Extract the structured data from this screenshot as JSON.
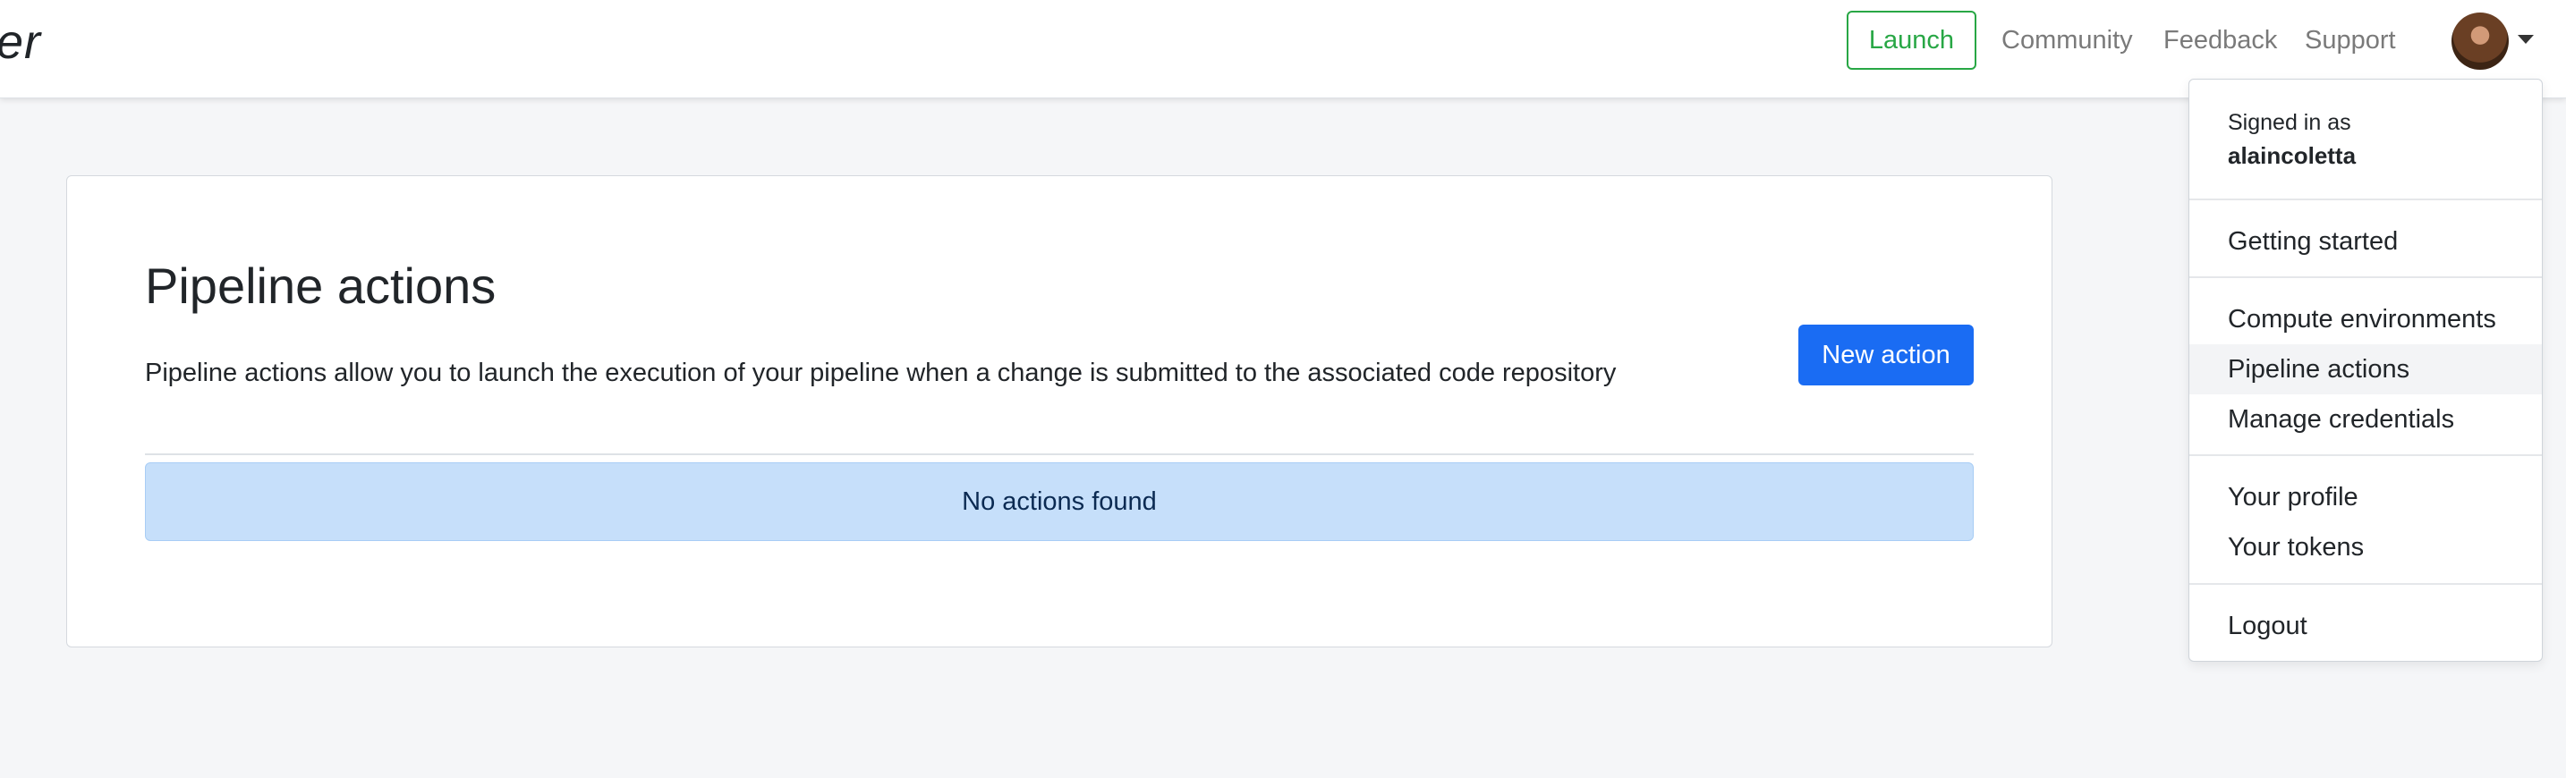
{
  "navbar": {
    "brand_text": "er",
    "launch_label": "Launch",
    "links": [
      "Community",
      "Feedback",
      "Support"
    ]
  },
  "main": {
    "title": "Pipeline actions",
    "description": "Pipeline actions allow you to launch the execution of your pipeline when a change is submitted to the associated code repository",
    "new_action_label": "New action",
    "empty_message": "No actions found"
  },
  "user_menu": {
    "signed_in_label": "Signed in as",
    "username": "alaincoletta",
    "items": [
      "Getting started",
      "Compute environments",
      "Pipeline actions",
      "Manage credentials",
      "Your profile",
      "Your tokens",
      "Logout"
    ],
    "active_item": "Pipeline actions"
  },
  "colors": {
    "launch": "#28a745",
    "primary": "#1a6cf3",
    "alert_bg": "#c6dffa",
    "page_bg": "#f5f6f8"
  }
}
